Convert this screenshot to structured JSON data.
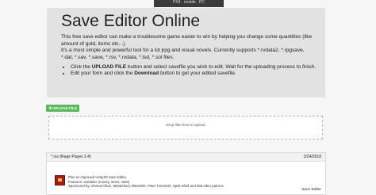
{
  "banner": "PS4 · mobile · PC",
  "jumbotron": {
    "title": "Save Editor Online",
    "intro1": "This free save editor can make a troublesome game easier to win by helping you change some quantities (like amount of gold, items etc...).",
    "intro2": "It's a most simple and powerful tool for a lot jrpg and visual novels. Currently supports *.rvdata2, *.rpgsave, *.dat, *.sav, *.save, *.rsv, *.rvdata, *.lsd, *.sol files.",
    "step1_a": "Click the ",
    "step1_b": "UPLOAD FILE",
    "step1_c": " button and select savefile you wish to edit. Wait for the uploading process to finish.",
    "step2_a": "Edit your form and click the ",
    "step2_b": "Download",
    "step2_c": " button to get your edited savefile."
  },
  "upload_button": {
    "icon": "plus-icon",
    "label": "UPLOAD FILE"
  },
  "dropzone": {
    "text": "Drop files here to upload"
  },
  "card": {
    "header": "*.rsv (Rage Player 2.4)",
    "date": "3/24/2018",
    "line1": "Plus an improved Unity3D Save Editor.",
    "line2": "Features: variables (money, items, stats)",
    "line3": "Sponsored by: Ohneat Olion, Masterkool, kitten900, Peter Trzemiski, Spirit Shell and 965 other patrons",
    "footer": "Save Editor"
  }
}
